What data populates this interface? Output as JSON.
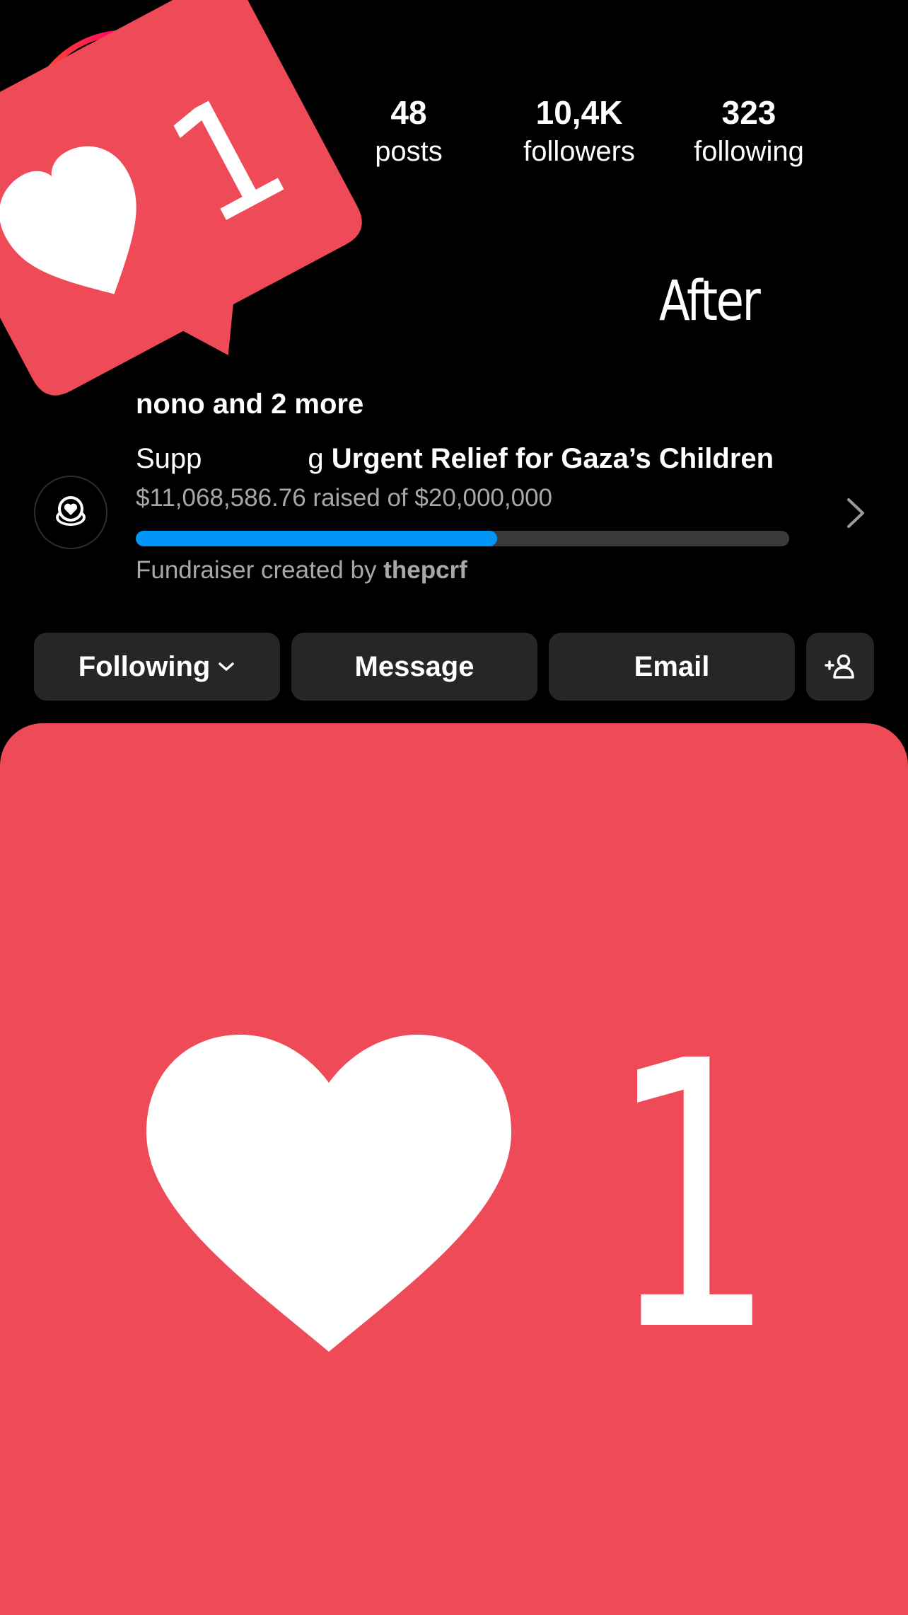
{
  "profile": {
    "stats": [
      {
        "id": "posts",
        "value": "48",
        "label": "posts"
      },
      {
        "id": "followers",
        "value": "10,4K",
        "label": "followers"
      },
      {
        "id": "following",
        "value": "323",
        "label": "following"
      }
    ],
    "followed_by_text": "nono and 2 more"
  },
  "caption": {
    "text": "After"
  },
  "fundraiser": {
    "title_prefix": "Supp",
    "title_suffix": "g",
    "title_bold": "Urgent Relief for Gaza’s Children",
    "amount_text": "$11,068,586.76 raised of $20,000,000",
    "progress_fraction": 0.553,
    "creator_prefix": "Fundraiser created by",
    "creator_name": "thepcrf",
    "icon": "heart-coin-icon",
    "chevron_icon": "chevron-right-icon"
  },
  "buttons": {
    "following": "Following",
    "message": "Message",
    "email": "Email",
    "add_user_icon": "add-user-icon"
  },
  "like_notification": {
    "count": "1",
    "icon": "heart-icon"
  },
  "colors": {
    "background": "#000000",
    "like_red": "#ee4a57",
    "progress_blue": "#0095f6",
    "button_gray": "#262626"
  }
}
